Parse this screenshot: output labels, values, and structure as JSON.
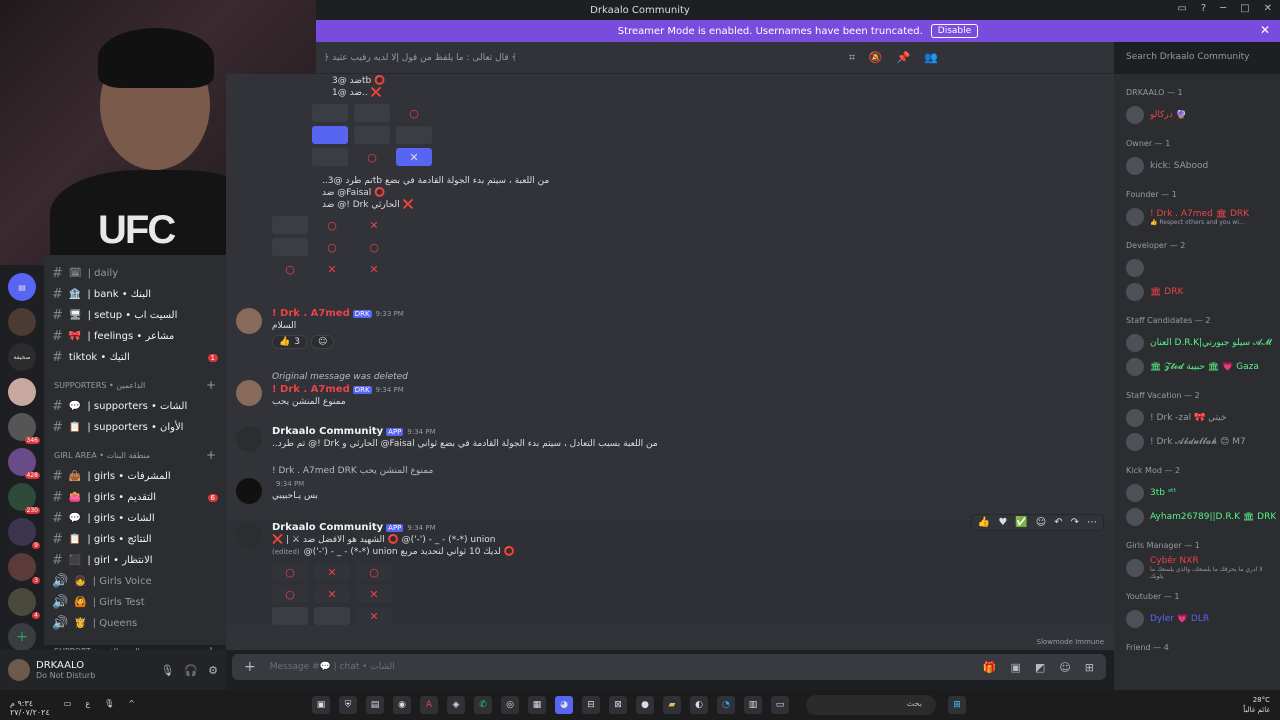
{
  "window": {
    "title": "Drkaalo Community"
  },
  "banner": {
    "text": "Streamer Mode is enabled. Usernames have been truncated.",
    "disable_label": "Disable"
  },
  "header": {
    "topic": "﴿ ﻗﺎﻝ ﺗﻌﺎﻟﻰ : ﻣﺎ ﻳﻠﻔﻆ ﻣﻦ ﻗﻮﻝ ﺇﻻ ﻟﺪﻳﻪ ﺭﻗﻴﺐ ﻋﺘﻴﺪ ﴾",
    "search_placeholder": "Search Drkaalo Community"
  },
  "webcam": {
    "shirt_text": "UFC"
  },
  "channels": {
    "items": [
      {
        "name": "| daily",
        "emoji": "🗓"
      },
      {
        "name": "| bank • البنك",
        "emoji": "🏦"
      },
      {
        "name": "| setup • السيت اب",
        "emoji": "🖥"
      },
      {
        "name": "| feelings • مشاعر",
        "emoji": "🎀"
      },
      {
        "name": "tiktok • التيك",
        "emoji": "",
        "mention": "1"
      }
    ],
    "cat_supporters": "Supporters • الداعمين",
    "supporters": [
      {
        "name": "| supporters • الشات",
        "emoji": "💬"
      },
      {
        "name": "| supporters • الأوان",
        "emoji": "📋"
      }
    ],
    "cat_girls": "GIRL AREA • منطقة البنات",
    "girls": [
      {
        "name": "| girls • المشرفات",
        "emoji": "👜"
      },
      {
        "name": "| girls • التقديم",
        "emoji": "👛",
        "mention": "6"
      },
      {
        "name": "| girls • الشات",
        "emoji": "💬"
      },
      {
        "name": "| girls • التتائج",
        "emoji": "📋"
      },
      {
        "name": "| girl • الانتظار",
        "emoji": "⬛"
      }
    ],
    "voice": [
      {
        "name": "| Girls Voice",
        "emoji": "👧"
      },
      {
        "name": "| Girls Test",
        "emoji": "🙆"
      },
      {
        "name": "| Queens",
        "emoji": "👸"
      }
    ],
    "cat_support": "SUPPORT • الدعم الفني"
  },
  "rail": {
    "badges": [
      "346",
      "428",
      "230",
      "9",
      "3",
      "4"
    ]
  },
  "user": {
    "name": "DRKAALO",
    "status": "Do Not Disturb"
  },
  "messages": {
    "top_lines": [
      "ضد @3tb ⭕",
      "ضد @1.. ❌",
      "..تم طرد @3tb من اللعبة ، سيتم بدء الجولة القادمة في بضع",
      "ضد @Faisal ⭕",
      "ضد @! Drk الحارثي ❌"
    ],
    "m1": {
      "author": "! Drk . A7med",
      "tag": "DRK",
      "time": "9:33 PM",
      "text": "السلام",
      "react_count": "3"
    },
    "m2": {
      "reply": "Original message was deleted",
      "author": "! Drk . A7med",
      "tag": "DRK",
      "time": "9:34 PM",
      "text": "ممنوع المنشن يحب"
    },
    "m3": {
      "author": "Drkaalo Community",
      "tag": "APP",
      "time": "9:34 PM",
      "text": "..تم طرد @! Drk الحارثي و @Faisal من اللعبة بسبب التعادل ، سيتم بدء الجولة القادمة في بضع ثواني"
    },
    "m4": {
      "reply": "! Drk . A7med DRK ممنوع المنشن يحب",
      "time": "9:34 PM",
      "text": "بس يـاحبيبي"
    },
    "m5": {
      "author": "Drkaalo Community",
      "tag": "APP",
      "time": "9:34 PM",
      "line1": "❌ | ⚔ الشهيد هو الافضل ضد ⭕ @('-') - _ - (*-*) union",
      "line2": "@('-') - _ - (*-*) union لديك 10 ثواني لتحديد مربع ⭕",
      "edited": "(edited)"
    },
    "slowmode": "Slowmode Immune"
  },
  "composer": {
    "placeholder": "Message #💬 | chat • الشات"
  },
  "members": {
    "groups": [
      {
        "role": "DRKAALO — 1",
        "members": [
          {
            "name": "دركالو 🔮",
            "color": "#ed4245"
          }
        ]
      },
      {
        "role": "Owner — 1",
        "members": [
          {
            "name": "kick: SAbood",
            "color": "#949ba4"
          }
        ]
      },
      {
        "role": "Founder — 1",
        "members": [
          {
            "name": "! Drk . A7med 🏛 DRK",
            "color": "#ed4245",
            "sub": "👍 Respect others and you wi..."
          }
        ]
      },
      {
        "role": "Developer — 2",
        "members": [
          {
            "name": "",
            "color": "#ed4245"
          },
          {
            "name": "🏛 DRK",
            "color": "#ed4245"
          }
        ]
      },
      {
        "role": "Staff Candidates — 2",
        "members": [
          {
            "name": "العنان D.R.K|سيلو جبورني 𝓐𝓜",
            "color": "#57f287"
          },
          {
            "name": "🏛 𝓩𝓽𝓸𝓭 حبيبة 🏛 💗 Gaza",
            "color": "#57f287"
          }
        ]
      },
      {
        "role": "Staff Vacation — 2",
        "members": [
          {
            "name": "! Drk -zal 🎀 خيتي",
            "color": "#949ba4"
          },
          {
            "name": "! Drk 𝓐𝓫𝓭𝓾𝓵𝓵𝓪𝓱 😊 M7",
            "color": "#949ba4"
          }
        ]
      },
      {
        "role": "Kick Mod — 2",
        "members": [
          {
            "name": "3tb ˢᵗᵗ",
            "color": "#57f287"
          },
          {
            "name": "Ayham26789||D.R.K 🏛 DRK",
            "color": "#57f287"
          }
        ]
      },
      {
        "role": "Girls Manager — 1",
        "members": [
          {
            "name": "Cyběr ÑXŔ",
            "color": "#ed4245",
            "sub": "لا ادري ما يحرقك ما يلسعك، والذي يلسعك ما يلويك"
          }
        ]
      },
      {
        "role": "Youtuber — 1",
        "members": [
          {
            "name": "Dyler 💗 DLR",
            "color": "#5865f2"
          }
        ]
      },
      {
        "role": "Friend — 4",
        "members": []
      }
    ]
  },
  "taskbar": {
    "time": "٩:٣٤ م",
    "date": "٢٧/٠٧/٢٠٢٤",
    "lang": "ع",
    "search": "بحث",
    "weather_temp": "28°C",
    "weather_desc": "غائم غالباً"
  }
}
